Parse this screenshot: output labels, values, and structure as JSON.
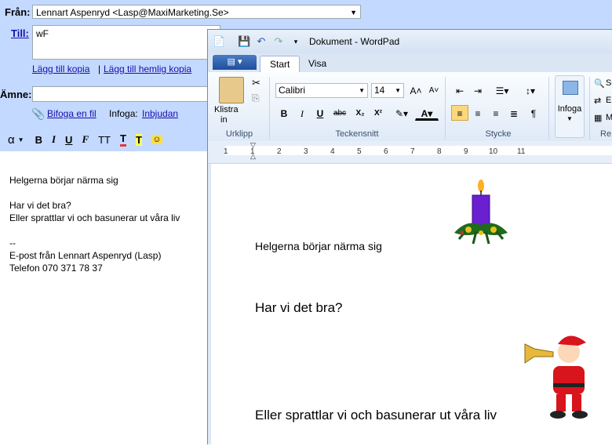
{
  "gmail": {
    "from_label": "Från:",
    "from_value": "Lennart Aspenryd <Lasp@MaxiMarketing.Se>",
    "to_label": "Till:",
    "to_value": "wF",
    "add_cc": "Lägg till kopia",
    "link_separator": "|",
    "add_bcc": "Lägg till hemlig kopia",
    "subject_label": "Ämne:",
    "subject_value": "",
    "attach_link": "Bifoga en fil",
    "insert_label": "Infoga:",
    "invite_link": "Inbjudan",
    "toolbar": {
      "font": "α",
      "bold": "B",
      "italic": "I",
      "underline": "U",
      "font_face": "F",
      "font_size": "TT",
      "text_color": "T",
      "highlight": "T",
      "emoji": "☺"
    },
    "body_lines": [
      "Helgerna börjar närma sig",
      "",
      "Har vi det bra?",
      "Eller sprattlar vi och basunerar ut våra liv",
      "",
      "--",
      "E-post från Lennart Aspenryd (Lasp)",
      "Telefon 070 371 78 37"
    ]
  },
  "wordpad": {
    "title": "Dokument - WordPad",
    "app_button_icon": "menu-icon",
    "tabs": [
      "Start",
      "Visa"
    ],
    "active_tab": "Start",
    "clipboard": {
      "paste_label_1": "Klistra",
      "paste_label_2": "in",
      "group": "Urklipp"
    },
    "font": {
      "family": "Calibri",
      "size": "14",
      "group": "Teckensnitt",
      "buttons": [
        "B",
        "I",
        "U",
        "abc",
        "X₂",
        "X²"
      ]
    },
    "paragraph": {
      "group": "Stycke"
    },
    "insert": {
      "label": "Infoga"
    },
    "editing_partial": [
      "Sö",
      "Er",
      "M"
    ],
    "editing_group_partial": "Re",
    "ruler_numbers": [
      "1",
      "1",
      "2",
      "3",
      "4",
      "5",
      "6",
      "7",
      "8",
      "9",
      "10",
      "11"
    ],
    "doc_lines": [
      "Helgerna börjar närma sig",
      "Har vi det bra?",
      "Eller sprattlar vi och basunerar ut våra liv"
    ]
  },
  "colors": {
    "gmail_blue": "#c3d9ff",
    "link": "#1a0dab",
    "wordpad_chrome": "#dfe9f5",
    "candle_purple": "#6a1fd0",
    "santa_red": "#d8141c"
  }
}
